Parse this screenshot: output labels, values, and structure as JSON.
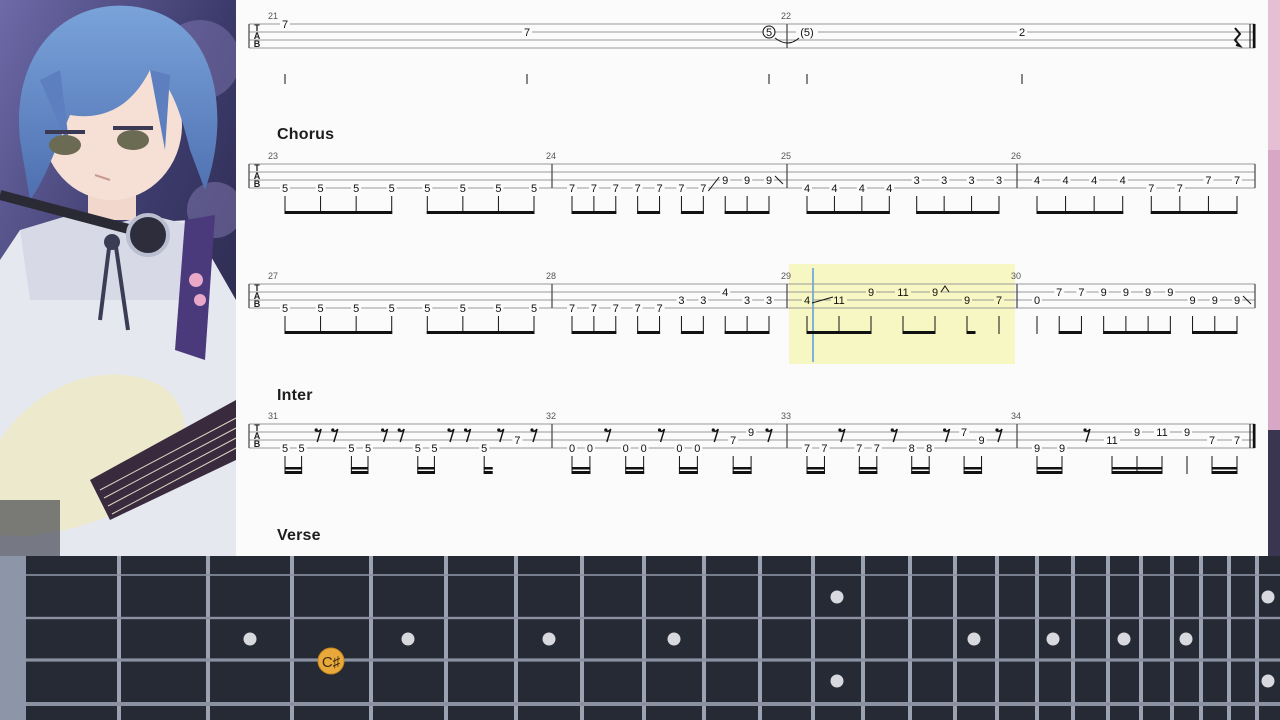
{
  "score": {
    "sections": [
      {
        "key": "chorus",
        "label": "Chorus"
      },
      {
        "key": "inter",
        "label": "Inter"
      },
      {
        "key": "verse",
        "label": "Verse"
      }
    ],
    "tab_clef": [
      "T",
      "A",
      "B"
    ],
    "rows": [
      {
        "measures": [
          {
            "number": "21",
            "notes": [
              {
                "f": "7",
                "s": 1,
                "stem": true
              },
              {
                "f": "7",
                "s": 2,
                "stem": true
              },
              {
                "f": "5",
                "s": 2,
                "circled": true,
                "stem": true
              }
            ],
            "tie_to_next": true
          },
          {
            "number": "22",
            "notes": [
              {
                "f": "(5)",
                "s": 2,
                "stem": true
              },
              {
                "f": "2",
                "s": 2,
                "stem": true
              },
              {
                "rest": "quarter"
              }
            ],
            "end": "double"
          }
        ]
      },
      {
        "measures": [
          {
            "number": "23",
            "notes": [
              {
                "f": "5",
                "s": 4
              },
              {
                "f": "5",
                "s": 4
              },
              {
                "f": "5",
                "s": 4
              },
              {
                "f": "5",
                "s": 4
              },
              {
                "f": "5",
                "s": 4
              },
              {
                "f": "5",
                "s": 4
              },
              {
                "f": "5",
                "s": 4
              },
              {
                "f": "5",
                "s": 4
              }
            ],
            "beams": [
              [
                0,
                3
              ],
              [
                4,
                7
              ]
            ]
          },
          {
            "number": "24",
            "notes": [
              {
                "f": "7",
                "s": 4
              },
              {
                "f": "7",
                "s": 4
              },
              {
                "f": "7",
                "s": 4
              },
              {
                "f": "7",
                "s": 4
              },
              {
                "f": "7",
                "s": 4
              },
              {
                "f": "7",
                "s": 4
              },
              {
                "f": "7",
                "s": 4
              },
              {
                "f": "9",
                "s": 3
              },
              {
                "f": "9",
                "s": 3
              },
              {
                "f": "9",
                "s": 3
              }
            ],
            "beams": [
              [
                0,
                2
              ],
              [
                3,
                4
              ],
              [
                5,
                6
              ],
              [
                7,
                9
              ]
            ],
            "slides": [
              [
                6,
                7
              ]
            ],
            "slide_out": [
              9
            ]
          },
          {
            "number": "25",
            "notes": [
              {
                "f": "4",
                "s": 4
              },
              {
                "f": "4",
                "s": 4
              },
              {
                "f": "4",
                "s": 4
              },
              {
                "f": "4",
                "s": 4
              },
              {
                "f": "3",
                "s": 3
              },
              {
                "f": "3",
                "s": 3
              },
              {
                "f": "3",
                "s": 3
              },
              {
                "f": "3",
                "s": 3
              }
            ],
            "beams": [
              [
                0,
                3
              ],
              [
                4,
                7
              ]
            ]
          },
          {
            "number": "26",
            "notes": [
              {
                "f": "4",
                "s": 3
              },
              {
                "f": "4",
                "s": 3
              },
              {
                "f": "4",
                "s": 3
              },
              {
                "f": "4",
                "s": 3
              },
              {
                "f": "7",
                "s": 4
              },
              {
                "f": "7",
                "s": 4
              },
              {
                "f": "7",
                "s": 3
              },
              {
                "f": "7",
                "s": 3
              }
            ],
            "beams": [
              [
                0,
                3
              ],
              [
                4,
                7
              ]
            ]
          }
        ]
      },
      {
        "measures": [
          {
            "number": "27",
            "notes": [
              {
                "f": "5",
                "s": 4
              },
              {
                "f": "5",
                "s": 4
              },
              {
                "f": "5",
                "s": 4
              },
              {
                "f": "5",
                "s": 4
              },
              {
                "f": "5",
                "s": 4
              },
              {
                "f": "5",
                "s": 4
              },
              {
                "f": "5",
                "s": 4
              },
              {
                "f": "5",
                "s": 4
              }
            ],
            "beams": [
              [
                0,
                3
              ],
              [
                4,
                7
              ]
            ]
          },
          {
            "number": "28",
            "notes": [
              {
                "f": "7",
                "s": 4
              },
              {
                "f": "7",
                "s": 4
              },
              {
                "f": "7",
                "s": 4
              },
              {
                "f": "7",
                "s": 4
              },
              {
                "f": "7",
                "s": 4
              },
              {
                "f": "3",
                "s": 3
              },
              {
                "f": "3",
                "s": 3
              },
              {
                "f": "4",
                "s": 2
              },
              {
                "f": "3",
                "s": 3
              },
              {
                "f": "3",
                "s": 3
              }
            ],
            "beams": [
              [
                0,
                2
              ],
              [
                3,
                4
              ],
              [
                5,
                6
              ],
              [
                7,
                9
              ]
            ]
          },
          {
            "number": "29",
            "highlight": true,
            "notes": [
              {
                "f": "4",
                "s": 3
              },
              {
                "f": "11",
                "s": 3
              },
              {
                "f": "9",
                "s": 2
              },
              {
                "f": "11",
                "s": 2
              },
              {
                "f": "9",
                "s": 2
              },
              {
                "f": "9",
                "s": 3
              },
              {
                "f": "7",
                "s": 3,
                "stem_alone": true
              }
            ],
            "beams": [
              [
                0,
                2
              ],
              [
                3,
                4
              ],
              [
                5,
                5
              ]
            ],
            "slides": [
              [
                0,
                1
              ]
            ],
            "bend_after": [
              4
            ]
          },
          {
            "number": "30",
            "notes": [
              {
                "f": "0",
                "s": 3,
                "stem_alone": true
              },
              {
                "f": "7",
                "s": 2
              },
              {
                "f": "7",
                "s": 2
              },
              {
                "f": "9",
                "s": 2
              },
              {
                "f": "9",
                "s": 2
              },
              {
                "f": "9",
                "s": 2
              },
              {
                "f": "9",
                "s": 2
              },
              {
                "f": "9",
                "s": 3
              },
              {
                "f": "9",
                "s": 3
              },
              {
                "f": "9",
                "s": 3
              }
            ],
            "beams": [
              [
                1,
                2
              ],
              [
                3,
                6
              ],
              [
                7,
                9
              ]
            ],
            "slide_out": [
              9
            ]
          }
        ]
      },
      {
        "measures": [
          {
            "number": "31",
            "notes": [
              {
                "f": "5",
                "s": 4
              },
              {
                "f": "5",
                "s": 4
              },
              {
                "rest": "8th"
              },
              {
                "rest": "8th"
              },
              {
                "f": "5",
                "s": 4
              },
              {
                "f": "5",
                "s": 4
              },
              {
                "rest": "8th"
              },
              {
                "rest": "8th"
              },
              {
                "f": "5",
                "s": 4
              },
              {
                "f": "5",
                "s": 4
              },
              {
                "rest": "8th"
              },
              {
                "rest": "8th"
              },
              {
                "f": "5",
                "s": 4
              },
              {
                "rest": "8th"
              },
              {
                "f": "7",
                "s": 3
              },
              {
                "rest": "8th"
              }
            ],
            "beams": [
              [
                0,
                1
              ],
              [
                4,
                5
              ],
              [
                8,
                9
              ],
              [
                12,
                12
              ]
            ]
          },
          {
            "number": "32",
            "notes": [
              {
                "f": "0",
                "s": 4
              },
              {
                "f": "0",
                "s": 4
              },
              {
                "rest": "8th"
              },
              {
                "f": "0",
                "s": 4
              },
              {
                "f": "0",
                "s": 4
              },
              {
                "rest": "8th"
              },
              {
                "f": "0",
                "s": 4
              },
              {
                "f": "0",
                "s": 4
              },
              {
                "rest": "8th"
              },
              {
                "f": "7",
                "s": 3
              },
              {
                "f": "9",
                "s": 2
              },
              {
                "rest": "8th"
              }
            ],
            "beams": [
              [
                0,
                1
              ],
              [
                3,
                4
              ],
              [
                6,
                7
              ],
              [
                9,
                10
              ]
            ]
          },
          {
            "number": "33",
            "notes": [
              {
                "f": "7",
                "s": 4
              },
              {
                "f": "7",
                "s": 4
              },
              {
                "rest": "8th"
              },
              {
                "f": "7",
                "s": 4
              },
              {
                "f": "7",
                "s": 4
              },
              {
                "rest": "8th"
              },
              {
                "f": "8",
                "s": 4
              },
              {
                "f": "8",
                "s": 4
              },
              {
                "rest": "8th"
              },
              {
                "f": "7",
                "s": 2
              },
              {
                "f": "9",
                "s": 3
              },
              {
                "rest": "8th"
              }
            ],
            "beams": [
              [
                0,
                1
              ],
              [
                3,
                4
              ],
              [
                6,
                7
              ],
              [
                9,
                10
              ]
            ]
          },
          {
            "number": "34",
            "notes": [
              {
                "f": "9",
                "s": 4
              },
              {
                "f": "9",
                "s": 4
              },
              {
                "rest": "8th"
              },
              {
                "f": "11",
                "s": 3
              },
              {
                "f": "9",
                "s": 2
              },
              {
                "f": "11",
                "s": 2
              },
              {
                "f": "9",
                "s": 2,
                "stem_alone": true
              },
              {
                "f": "7",
                "s": 3
              },
              {
                "f": "7",
                "s": 3
              }
            ],
            "beams": [
              [
                0,
                1
              ],
              [
                3,
                5
              ],
              [
                7,
                8
              ]
            ],
            "end": "double"
          }
        ]
      }
    ]
  },
  "fretboard": {
    "active_note": {
      "label": "C♯",
      "color": "#e8a93a"
    }
  }
}
